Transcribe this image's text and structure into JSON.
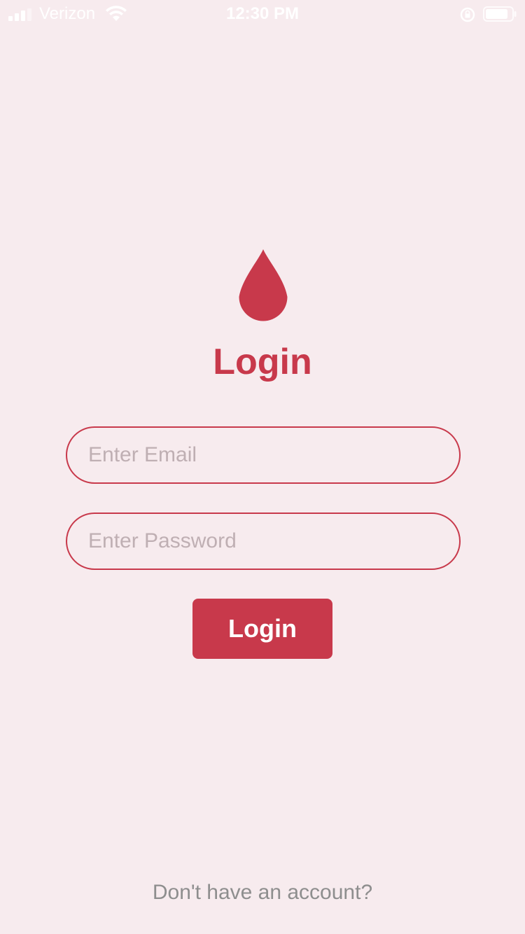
{
  "status_bar": {
    "carrier": "Verizon",
    "time": "12:30 PM",
    "icons": [
      "signal-icon",
      "wifi-icon",
      "rotation-lock-icon",
      "battery-icon"
    ]
  },
  "logo": {
    "icon": "blood-drop-icon"
  },
  "colors": {
    "accent": "#C8394B",
    "background": "#F7EBEE",
    "placeholder": "#BFAFB3",
    "muted_text": "#8E8E8E"
  },
  "login": {
    "title": "Login",
    "email_placeholder": "Enter Email",
    "email_value": "",
    "password_placeholder": "Enter Password",
    "password_value": "",
    "button_label": "Login"
  },
  "footer": {
    "signup_prompt": "Don't have an account?"
  }
}
